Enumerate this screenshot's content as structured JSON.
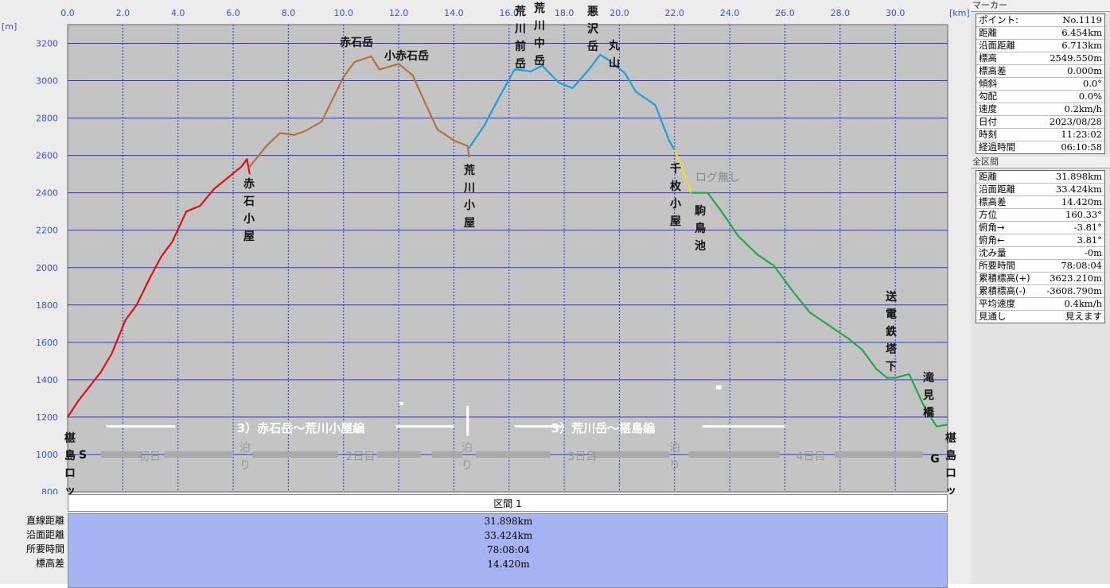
{
  "chart_data": {
    "type": "line",
    "x_unit": "[km]",
    "y_unit": "[m]",
    "xlim": [
      0,
      31.898
    ],
    "ylim": [
      800,
      3300
    ],
    "x_ticks": [
      "0.0",
      "2.0",
      "4.0",
      "6.0",
      "8.0",
      "10.0",
      "12.0",
      "14.0",
      "16.0",
      "18.0",
      "20.0",
      "22.0",
      "24.0",
      "26.0",
      "28.0",
      "30.0"
    ],
    "y_ticks": [
      "3200",
      "3000",
      "2800",
      "2600",
      "2400",
      "2200",
      "2000",
      "1800",
      "1600",
      "1400",
      "1200",
      "1000",
      "800"
    ],
    "series": [
      {
        "color": "#e01010",
        "points": [
          [
            0,
            1200
          ],
          [
            0.4,
            1290
          ],
          [
            1.2,
            1440
          ],
          [
            1.6,
            1540
          ],
          [
            2.1,
            1720
          ],
          [
            2.5,
            1800
          ],
          [
            3.0,
            1950
          ],
          [
            3.4,
            2060
          ],
          [
            3.8,
            2140
          ],
          [
            4.3,
            2300
          ],
          [
            4.8,
            2330
          ],
          [
            5.3,
            2420
          ],
          [
            5.8,
            2480
          ],
          [
            6.3,
            2540
          ],
          [
            6.5,
            2580
          ],
          [
            6.6,
            2500
          ]
        ]
      },
      {
        "color": "#b5703f",
        "points": [
          [
            6.6,
            2540
          ],
          [
            7.2,
            2650
          ],
          [
            7.7,
            2720
          ],
          [
            8.2,
            2710
          ],
          [
            8.6,
            2730
          ],
          [
            9.2,
            2780
          ],
          [
            9.6,
            2900
          ],
          [
            10.0,
            3020
          ],
          [
            10.4,
            3100
          ],
          [
            11.0,
            3130
          ],
          [
            11.3,
            3060
          ],
          [
            12.0,
            3090
          ],
          [
            12.5,
            3030
          ],
          [
            12.9,
            2900
          ],
          [
            13.4,
            2740
          ],
          [
            14.0,
            2680
          ],
          [
            14.5,
            2650
          ],
          [
            14.55,
            2590
          ]
        ]
      },
      {
        "color": "#1aa0dd",
        "points": [
          [
            14.55,
            2640
          ],
          [
            15.1,
            2760
          ],
          [
            15.6,
            2900
          ],
          [
            16.2,
            3060
          ],
          [
            16.8,
            3050
          ],
          [
            17.2,
            3080
          ],
          [
            17.8,
            2990
          ],
          [
            18.3,
            2960
          ],
          [
            18.9,
            3060
          ],
          [
            19.3,
            3140
          ],
          [
            19.7,
            3100
          ],
          [
            20.2,
            3040
          ],
          [
            20.6,
            2940
          ],
          [
            21.3,
            2870
          ],
          [
            21.8,
            2680
          ],
          [
            22.0,
            2630
          ]
        ]
      },
      {
        "color": "#f0e020",
        "points": [
          [
            22.0,
            2630
          ],
          [
            22.3,
            2520
          ],
          [
            22.6,
            2400
          ]
        ]
      },
      {
        "color": "#22aa44",
        "points": [
          [
            22.6,
            2400
          ],
          [
            23.2,
            2400
          ],
          [
            23.7,
            2300
          ],
          [
            24.3,
            2170
          ],
          [
            25.0,
            2070
          ],
          [
            25.6,
            2010
          ],
          [
            26.3,
            1870
          ],
          [
            26.9,
            1760
          ],
          [
            27.6,
            1690
          ],
          [
            28.3,
            1620
          ],
          [
            28.8,
            1560
          ],
          [
            29.3,
            1460
          ],
          [
            29.7,
            1410
          ],
          [
            30.0,
            1410
          ],
          [
            30.5,
            1430
          ],
          [
            31.1,
            1240
          ],
          [
            31.5,
            1150
          ],
          [
            31.898,
            1160
          ]
        ]
      }
    ],
    "place_labels": [
      {
        "text": "椹島ロッジ",
        "x": 0.0,
        "vertical": true
      },
      {
        "text": "S",
        "x": 1.1,
        "vertical": false
      },
      {
        "text": "赤石小屋",
        "x": 6.5,
        "vertical": true
      },
      {
        "text": "赤石岳",
        "x": 10.5,
        "vertical": false
      },
      {
        "text": "小赤石岳",
        "x": 12.2,
        "vertical": false
      },
      {
        "text": "荒川小屋",
        "x": 14.5,
        "vertical": true
      },
      {
        "text": "荒川前岳",
        "x": 16.3,
        "vertical": true
      },
      {
        "text": "荒川中岳",
        "x": 17.0,
        "vertical": true
      },
      {
        "text": "悪沢岳",
        "x": 19.2,
        "vertical": true
      },
      {
        "text": "丸山",
        "x": 19.9,
        "vertical": true
      },
      {
        "text": "千枚小屋",
        "x": 22.0,
        "vertical": true
      },
      {
        "text": "ログ無し",
        "x": 23.5,
        "vertical": false
      },
      {
        "text": "駒鳥池",
        "x": 22.9,
        "vertical": true
      },
      {
        "text": "送電鉄塔下",
        "x": 29.8,
        "vertical": true
      },
      {
        "text": "滝見橋",
        "x": 31.1,
        "vertical": true
      },
      {
        "text": "G",
        "x": 31.2,
        "vertical": false
      },
      {
        "text": "椹島ロッジ",
        "x": 31.898,
        "vertical": true
      }
    ],
    "day_labels": [
      {
        "text": "初日",
        "x": 3.0
      },
      {
        "text": "泊り",
        "x": 6.3,
        "vertical": true
      },
      {
        "text": "2日目",
        "x": 10.5
      },
      {
        "text": "泊り",
        "x": 14.5,
        "vertical": true
      },
      {
        "text": "3日目",
        "x": 18.5
      },
      {
        "text": "泊り",
        "x": 22.0,
        "vertical": true
      },
      {
        "text": "4日目",
        "x": 27.0
      }
    ],
    "section_labels": [
      {
        "text": "3）赤石岳～荒川小屋編",
        "x": 8.9
      },
      {
        "text": "3）荒川岳～椹島編",
        "x": 20.0
      }
    ]
  },
  "summary": {
    "header": "区間 1",
    "rows": [
      {
        "label": "直線距離",
        "value": "31.898km"
      },
      {
        "label": "沿面距離",
        "value": "33.424km"
      },
      {
        "label": "所要時間",
        "value": "78:08:04"
      },
      {
        "label": "標高差",
        "value": "14.420m"
      }
    ]
  },
  "marker_panel": {
    "title": "マーカー",
    "rows": [
      {
        "k": "ポイント:",
        "v": "No.1119"
      },
      {
        "k": "距離",
        "v": "6.454km"
      },
      {
        "k": "沿面距離",
        "v": "6.713km"
      },
      {
        "k": "標高",
        "v": "2549.550m"
      },
      {
        "k": "標高差",
        "v": "0.000m"
      },
      {
        "k": "傾斜",
        "v": "0.0°"
      },
      {
        "k": "勾配",
        "v": "0.0%"
      },
      {
        "k": "速度",
        "v": "0.2km/h"
      },
      {
        "k": "日付",
        "v": "2023/08/28"
      },
      {
        "k": "時刻",
        "v": "11:23:02"
      },
      {
        "k": "経過時間",
        "v": "06:10:58"
      }
    ]
  },
  "whole_panel": {
    "title": "全区間",
    "rows": [
      {
        "k": "距離",
        "v": "31.898km"
      },
      {
        "k": "沿面距離",
        "v": "33.424km"
      },
      {
        "k": "標高差",
        "v": "14.420m"
      },
      {
        "k": "方位",
        "v": "160.33°"
      },
      {
        "k": "俯角→",
        "v": "-3.81°"
      },
      {
        "k": "俯角←",
        "v": "3.81°"
      },
      {
        "k": "沈み量",
        "v": "-0m"
      },
      {
        "k": "所要時間",
        "v": "78:08:04"
      },
      {
        "k": "累積標高(+)",
        "v": "3623.210m"
      },
      {
        "k": "累積標高(-)",
        "v": "-3608.790m"
      },
      {
        "k": "平均速度",
        "v": "0.4km/h"
      },
      {
        "k": "見通し",
        "v": "見えます"
      }
    ]
  }
}
